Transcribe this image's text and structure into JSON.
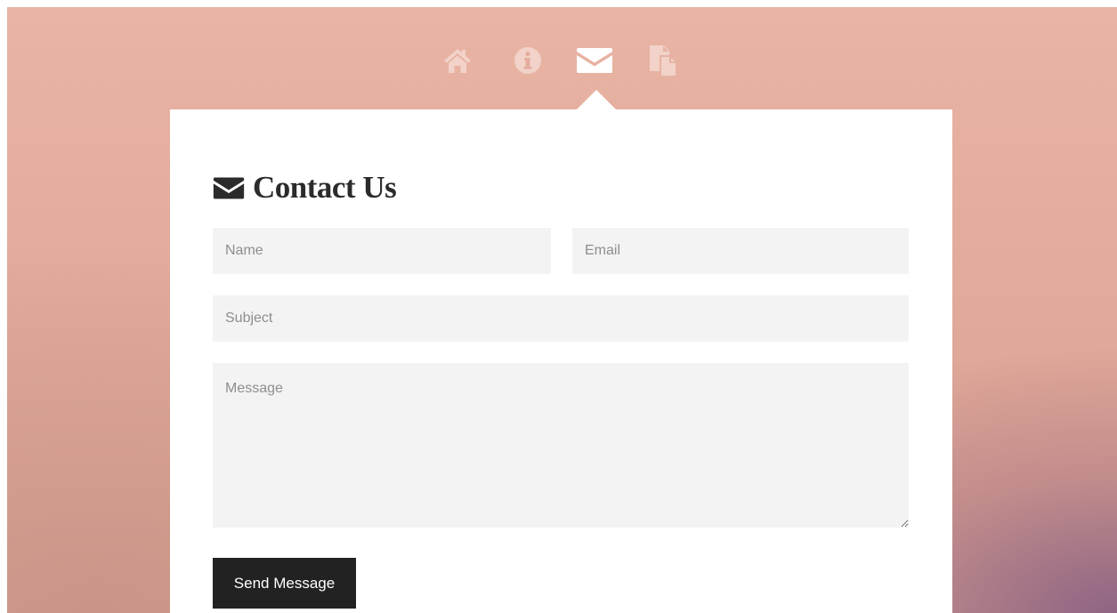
{
  "nav": {
    "items": [
      {
        "icon": "home-icon",
        "active": false
      },
      {
        "icon": "info-icon",
        "active": false
      },
      {
        "icon": "envelope-icon",
        "active": true
      },
      {
        "icon": "documents-icon",
        "active": false
      }
    ]
  },
  "contact": {
    "heading": "Contact Us",
    "heading_icon": "envelope-icon",
    "name_placeholder": "Name",
    "email_placeholder": "Email",
    "subject_placeholder": "Subject",
    "message_placeholder": "Message",
    "send_label": "Send Message"
  },
  "colors": {
    "background_top": "#e9b4a4",
    "background_corner": "#8a5f85",
    "panel": "#ffffff",
    "field": "#f3f3f3",
    "button": "#222222",
    "heading": "#2b2b2b"
  }
}
